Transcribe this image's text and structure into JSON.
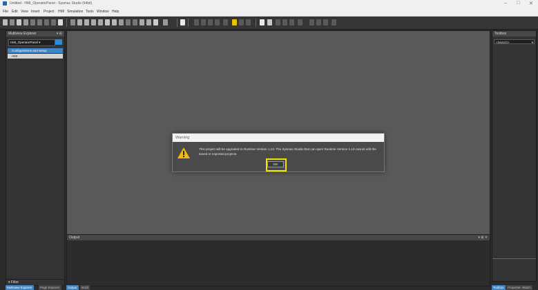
{
  "window": {
    "title": "Untitled - HMI_OperatorPanel - Sysmac Studio (64bit)",
    "controls": [
      "–",
      "□",
      "✕"
    ]
  },
  "menu": [
    "File",
    "Edit",
    "View",
    "Insert",
    "Project",
    "HMI",
    "Simulation",
    "Tools",
    "Window",
    "Help"
  ],
  "explorer": {
    "title": "Multiview Explorer",
    "project_selector": "HMI_OperatorPanel",
    "items": [
      "Configurations and Setup",
      "HMI"
    ],
    "filter_label": "Filter",
    "tabs": [
      "Multiview Explorer",
      "Page Explorer"
    ]
  },
  "output": {
    "title": "Output",
    "tabs": [
      "Output",
      "Build"
    ]
  },
  "toolbox": {
    "title": "Toolbox",
    "search_placeholder": "<Search>",
    "tabs": [
      "Toolbox",
      "Properties",
      "Watch"
    ]
  },
  "dialog": {
    "title": "Warning",
    "message": "This project will be upgraded to Runtime Version 1.13. The Sysmac Studio that can open Runtime Version 1.13 cannot edit the saved or exported projects.",
    "ok_label": "OK"
  },
  "colors": {
    "accent": "#2d8ad8",
    "highlight": "#f5e400",
    "warning": "#f2b90c"
  }
}
